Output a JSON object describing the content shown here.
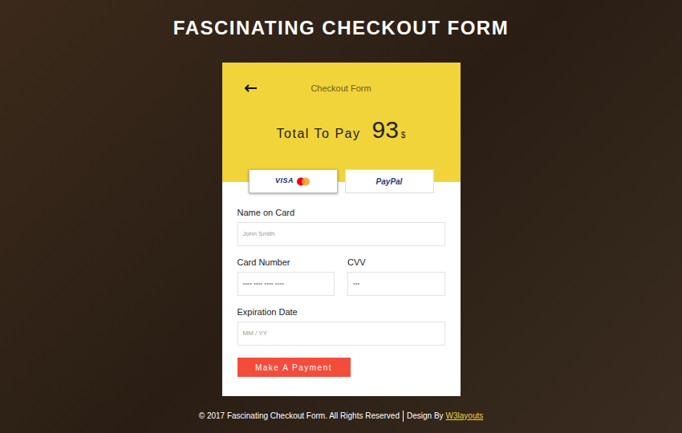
{
  "page": {
    "title": "FASCINATING CHECKOUT FORM"
  },
  "card": {
    "title": "Checkout Form",
    "total_label": "Total To Pay",
    "amount": "93",
    "currency": "$"
  },
  "payment_methods": [
    {
      "label": "VISA",
      "kind": "card",
      "selected": true
    },
    {
      "label": "PayPal",
      "kind": "paypal",
      "selected": false
    }
  ],
  "field_rows": [
    [
      {
        "label": "Name on Card",
        "placeholder": "John Smith"
      }
    ],
    [
      {
        "label": "Card Number",
        "placeholder": "•••• •••• •••• ••••"
      },
      {
        "label": "CVV",
        "placeholder": "•••"
      }
    ],
    [
      {
        "label": "Expiration Date",
        "placeholder": "MM / YY"
      }
    ]
  ],
  "submit": "Make A Payment",
  "footer": {
    "copyright": "© 2017 Fascinating Checkout Form. All Rights Reserved",
    "design_by": "Design By",
    "link": "W3layouts"
  }
}
